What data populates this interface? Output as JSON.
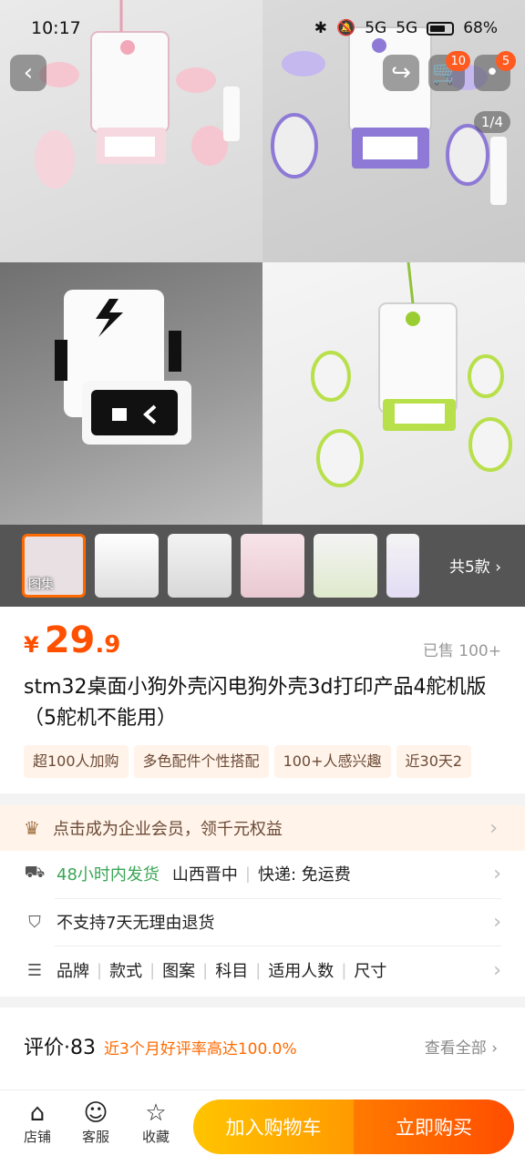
{
  "status": {
    "time": "10:17",
    "battery": "68%",
    "net1": "5G",
    "net2": "5G"
  },
  "gallery": {
    "page": "1/4",
    "cart_badge": "10",
    "more_badge": "5"
  },
  "thumbs": {
    "first_label": "图集",
    "styles_count": "共5款"
  },
  "product": {
    "yen": "¥",
    "price_int": "29",
    "price_dec": ".9",
    "sold": "已售 100+",
    "title": "stm32桌面小狗外壳闪电狗外壳3d打印产品4舵机版（5舵机不能用）",
    "tags": [
      "超100人加购",
      "多色配件个性搭配",
      "100+人感兴趣",
      "近30天2"
    ]
  },
  "member": {
    "text": "点击成为企业会员，领千元权益"
  },
  "delivery": {
    "ship": "48小时内发货",
    "from": "山西晋中",
    "express": "快递: 免运费"
  },
  "returns": {
    "text": "不支持7天无理由退货"
  },
  "specs": {
    "items": [
      "品牌",
      "款式",
      "图案",
      "科目",
      "适用人数",
      "尺寸"
    ]
  },
  "review": {
    "title": "评价·83",
    "sub": "近3个月好评率高达100.0%",
    "view_all": "查看全部"
  },
  "bottom": {
    "shop": "店铺",
    "service": "客服",
    "fav": "收藏",
    "add_cart": "加入购物车",
    "buy_now": "立即购买"
  },
  "colors": {
    "accent": "#ff5000",
    "green": "#3aa655",
    "tag_bg": "#fff3ea"
  }
}
